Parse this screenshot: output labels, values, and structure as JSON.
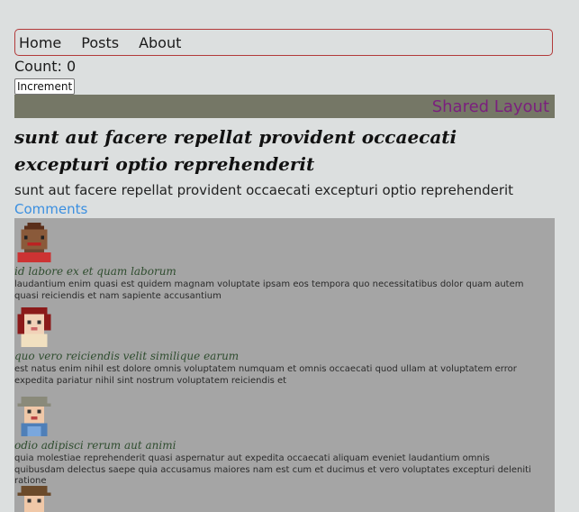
{
  "nav": {
    "items": [
      "Home",
      "Posts",
      "About"
    ]
  },
  "counter": {
    "label": "Count: 0",
    "button_label": "Increment"
  },
  "layout": {
    "label": "Shared Layout"
  },
  "post": {
    "title": "sunt aut facere repellat provident occaecati excepturi optio reprehenderit",
    "body": "sunt aut facere repellat provident occaecati excepturi optio reprehenderit",
    "comments_link": "Comments"
  },
  "comments": [
    {
      "name": "id labore ex et quam laborum",
      "body": "laudantium enim quasi est quidem magnam voluptate ipsam eos tempora quo necessitatibus dolor quam autem quasi reiciendis et nam sapiente accusantium",
      "avatar": "avatar-dark-skin-red-top"
    },
    {
      "name": "quo vero reiciendis velit similique earum",
      "body": "est natus enim nihil est dolore omnis voluptatem numquam et omnis occaecati quod ullam at voluptatem error expedita pariatur nihil sint nostrum voluptatem reiciendis et",
      "avatar": "avatar-red-hair"
    },
    {
      "name": "odio adipisci rerum aut animi",
      "body": "quia molestiae reprehenderit quasi aspernatur aut expedita occaecati aliquam eveniet laudantium omnis quibusdam delectus saepe quia accusamus maiores nam est cum et ducimus et vero voluptates excepturi deleniti ratione",
      "avatar": "avatar-cap-overalls"
    },
    {
      "name": "",
      "body": "",
      "avatar": "avatar-brown-hat"
    }
  ],
  "colors": {
    "background": "#dcdfdf",
    "nav_border": "#b23a3a",
    "shared_layout_bg": "#757766",
    "shared_layout_text": "#7b1f7e",
    "comments_link": "#3b8fe0",
    "comments_panel": "#a5a5a5",
    "comment_name": "#2f4d2f"
  }
}
